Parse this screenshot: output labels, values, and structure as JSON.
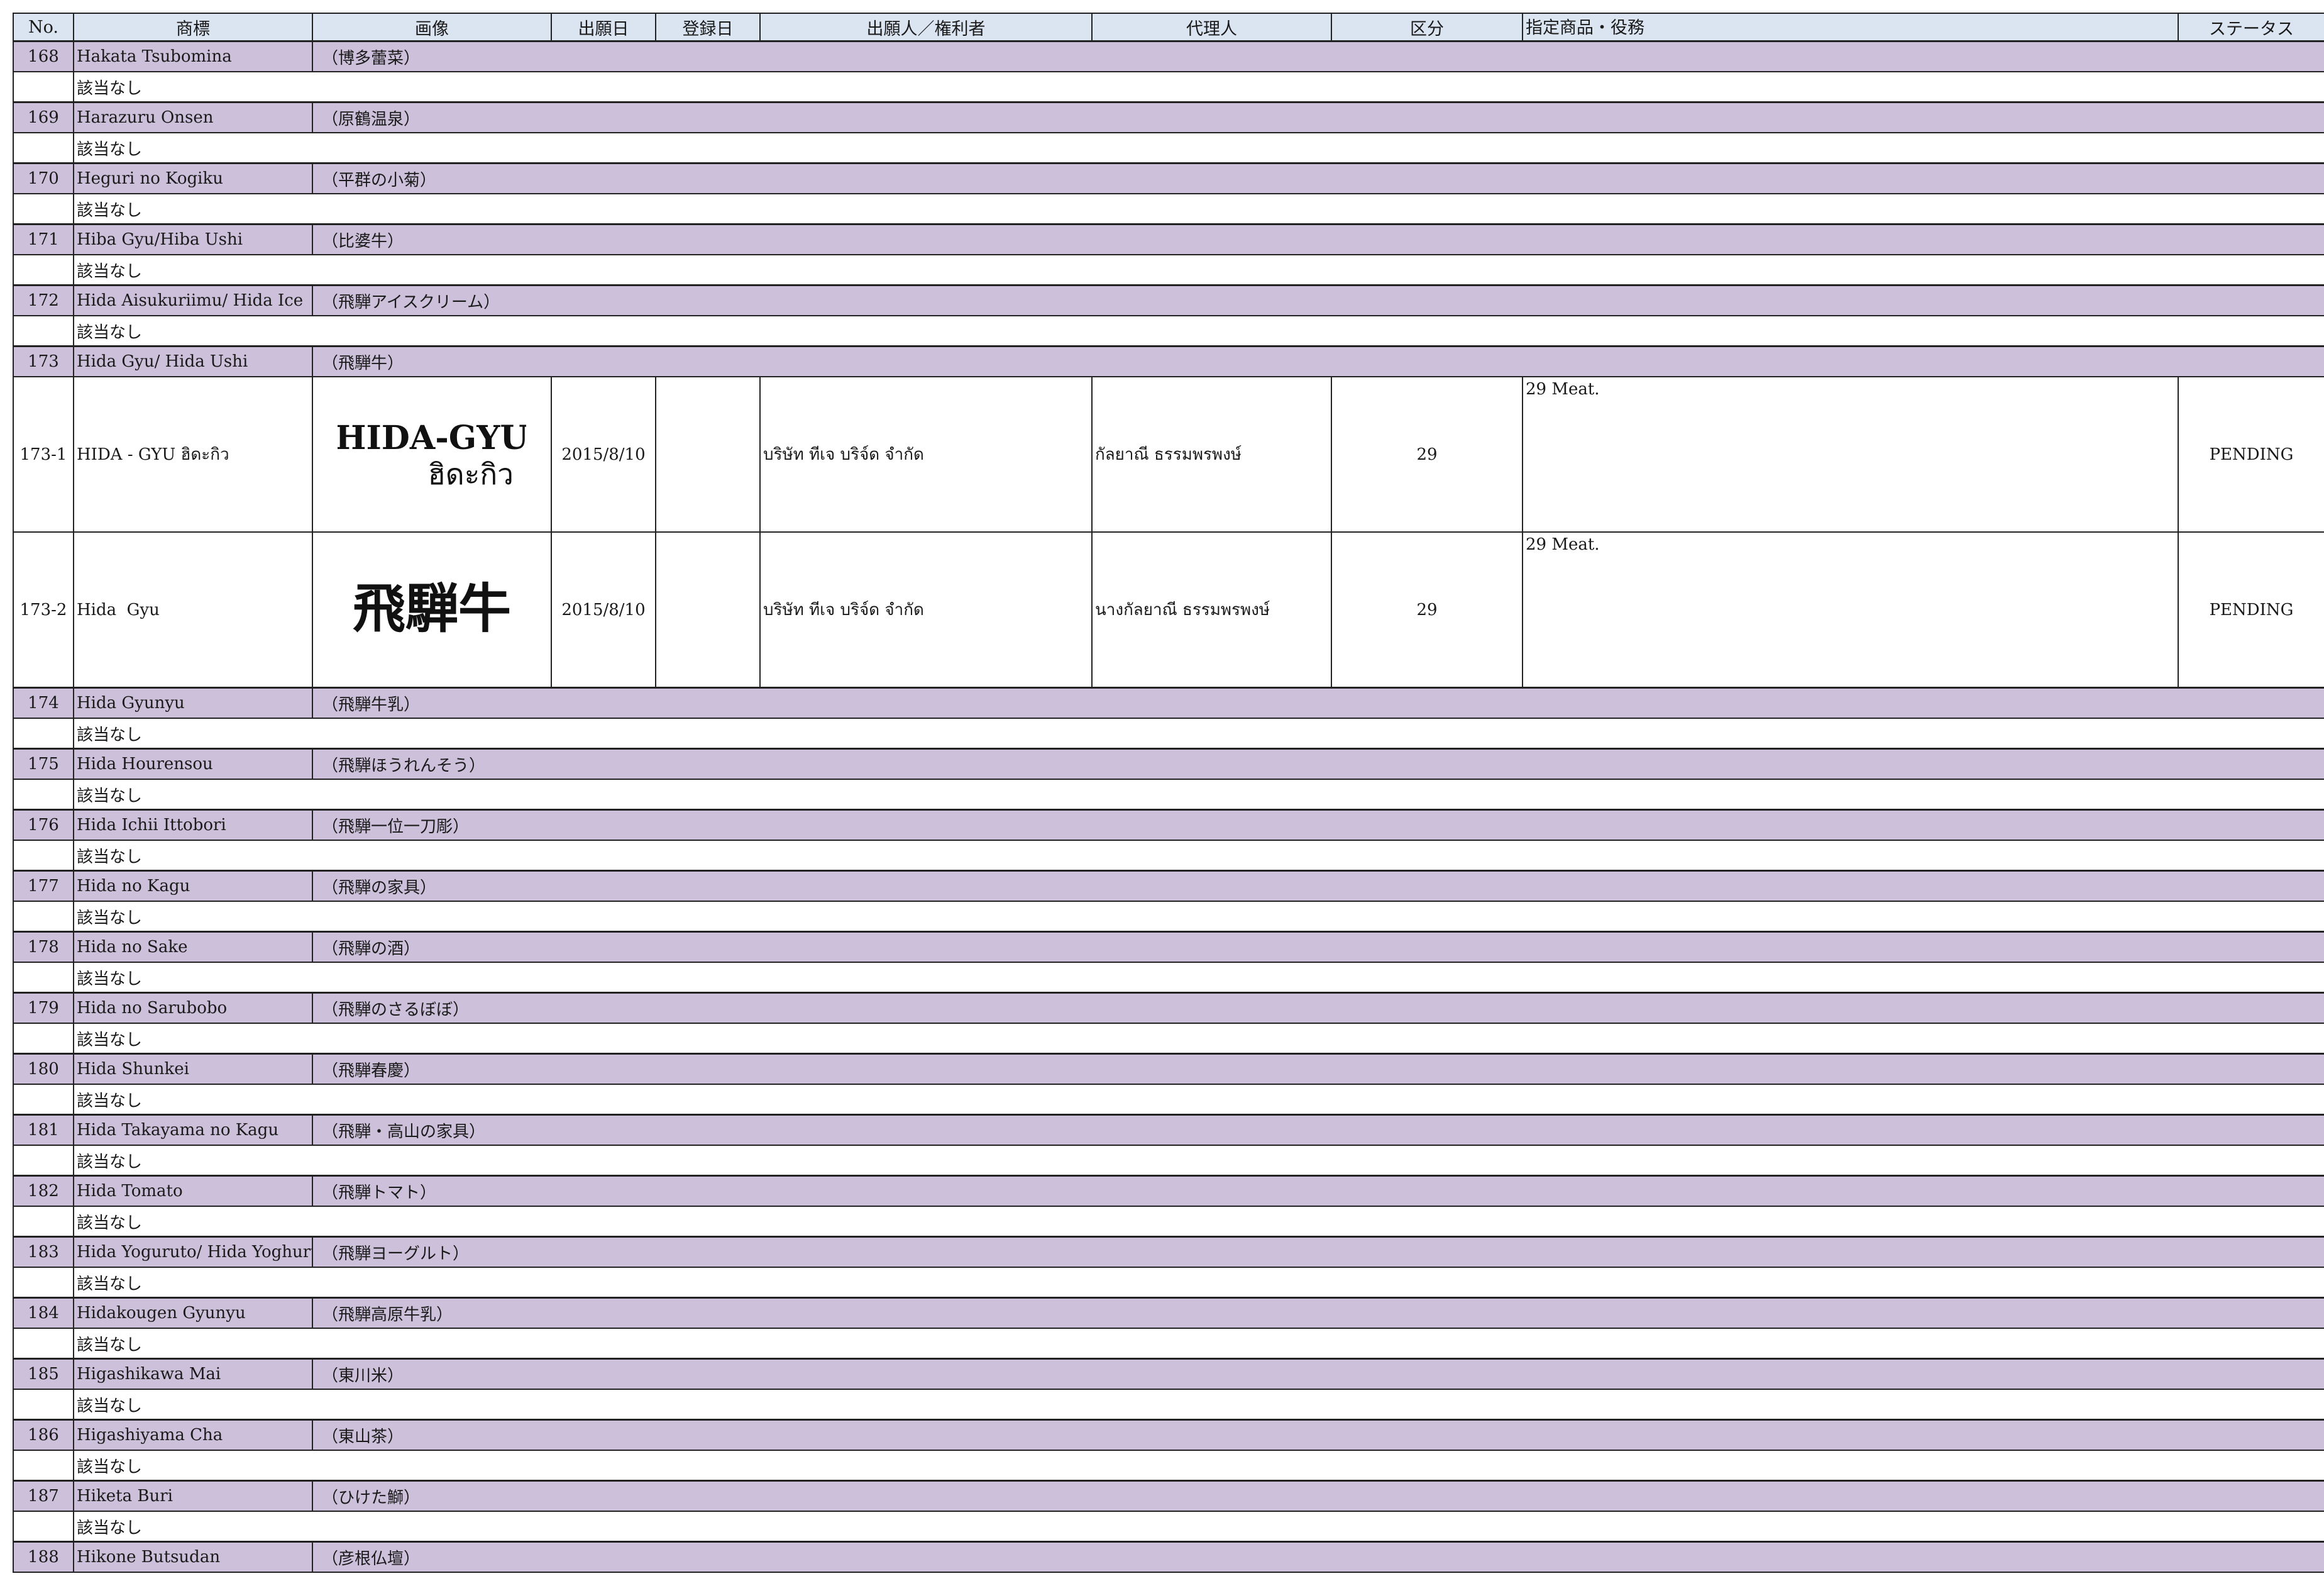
{
  "columns": [
    "No.",
    "商標",
    "画像",
    "出願日",
    "登録日",
    "出願人／権利者",
    "代理人",
    "区分",
    "指定商品・役務",
    "ステータス"
  ],
  "rows_before": [
    {
      "no": "168",
      "name": "Hakata Tsubomina",
      "jp": "（博多蕾菜）",
      "note": "該当なし"
    },
    {
      "no": "169",
      "name": "Harazuru Onsen",
      "jp": "（原鶴温泉）",
      "note": "該当なし"
    },
    {
      "no": "170",
      "name": "Heguri no Kogiku",
      "jp": "（平群の小菊）",
      "note": "該当なし"
    },
    {
      "no": "171",
      "name": "Hiba Gyu/Hiba Ushi",
      "jp": "（比婆牛）",
      "note": "該当なし"
    },
    {
      "no": "172",
      "name": "Hida Aisukuriimu/ Hida Ice",
      "jp": "（飛騨アイスクリーム）",
      "note": "該当なし"
    }
  ],
  "group_173": {
    "no": "173",
    "name": "Hida Gyu/ Hida Ushi",
    "jp": "（飛騨牛）"
  },
  "details": [
    {
      "no": "173-1",
      "mark": "HIDA - GYU ฮิดะกิว",
      "image_text": "HIDA-GYU ฮิดะกิว",
      "filing_date": "2015/8/10",
      "registration_date": "",
      "applicant": "บริษัท ทีเจ บริจ์ด จำกัด",
      "agent": "กัลยาณี ธรรมพรพงษ์",
      "class": "29",
      "goods": "29 Meat.",
      "status": "PENDING"
    },
    {
      "no": "173-2",
      "mark": "Hida  Gyu",
      "image_text": "飛騨牛",
      "filing_date": "2015/8/10",
      "registration_date": "",
      "applicant": "บริษัท ทีเจ บริจ์ด จำกัด",
      "agent": "นางกัลยาณี ธรรมพรพงษ์",
      "class": "29",
      "goods": "29 Meat.",
      "status": "PENDING"
    }
  ],
  "rows_after": [
    {
      "no": "174",
      "name": "Hida Gyunyu",
      "jp": "（飛騨牛乳）",
      "note": "該当なし"
    },
    {
      "no": "175",
      "name": "Hida Hourensou",
      "jp": "（飛騨ほうれんそう）",
      "note": "該当なし"
    },
    {
      "no": "176",
      "name": "Hida Ichii Ittobori",
      "jp": "（飛騨一位一刀彫）",
      "note": "該当なし"
    },
    {
      "no": "177",
      "name": "Hida no Kagu",
      "jp": "（飛騨の家具）",
      "note": "該当なし"
    },
    {
      "no": "178",
      "name": "Hida no Sake",
      "jp": "（飛騨の酒）",
      "note": "該当なし"
    },
    {
      "no": "179",
      "name": "Hida no Sarubobo",
      "jp": "（飛騨のさるぼぼ）",
      "note": "該当なし"
    },
    {
      "no": "180",
      "name": "Hida Shunkei",
      "jp": "（飛騨春慶）",
      "note": "該当なし"
    },
    {
      "no": "181",
      "name": "Hida Takayama no Kagu",
      "jp": "（飛騨・高山の家具）",
      "note": "該当なし"
    },
    {
      "no": "182",
      "name": "Hida Tomato",
      "jp": "（飛騨トマト）",
      "note": "該当なし"
    },
    {
      "no": "183",
      "name": "Hida Yoguruto/ Hida Yoghurt",
      "jp": "（飛騨ヨーグルト）",
      "note": "該当なし"
    },
    {
      "no": "184",
      "name": "Hidakougen Gyunyu",
      "jp": "（飛騨高原牛乳）",
      "note": "該当なし"
    },
    {
      "no": "185",
      "name": "Higashikawa Mai",
      "jp": "（東川米）",
      "note": "該当なし"
    },
    {
      "no": "186",
      "name": "Higashiyama Cha",
      "jp": "（東山茶）",
      "note": "該当なし"
    },
    {
      "no": "187",
      "name": "Hiketa Buri",
      "jp": "（ひけた鰤）",
      "note": "該当なし"
    },
    {
      "no": "188",
      "name": "Hikone Butsudan",
      "jp": "（彦根仏壇）",
      "note": ""
    }
  ]
}
